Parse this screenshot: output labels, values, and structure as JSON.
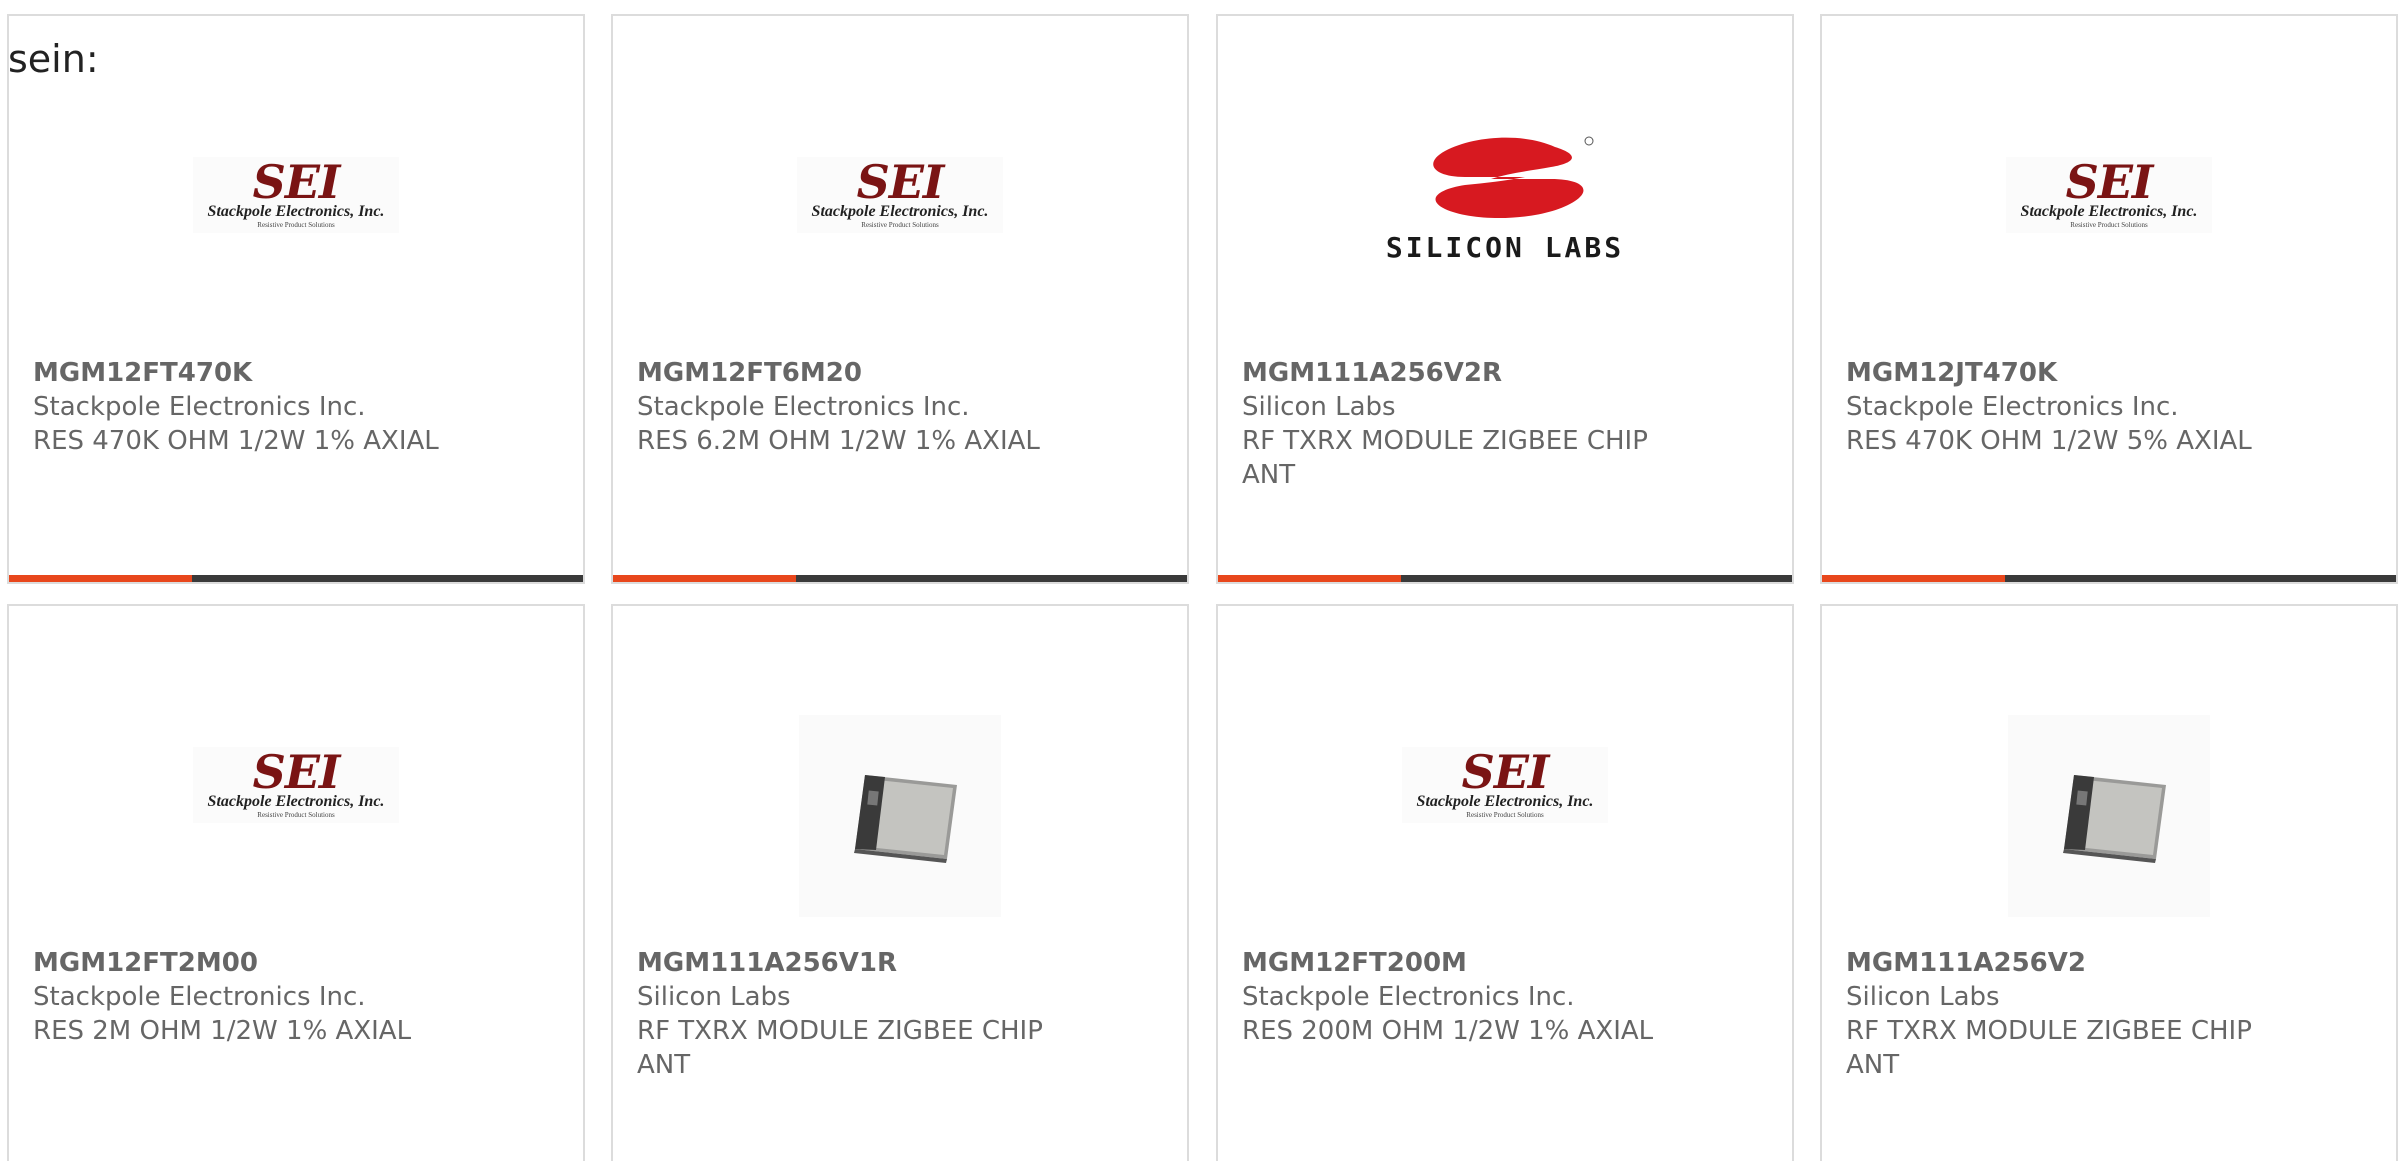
{
  "intro_text": "sein:",
  "colors": {
    "accent": "#e8471c",
    "bar_dark": "#3a3a3a",
    "sei_red": "#7a1414",
    "silabs_red": "#d71920",
    "text_gray": "#666666",
    "card_border": "#dcdcdc"
  },
  "sei_logo": {
    "mark": "SEI",
    "name": "Stackpole Electronics, Inc.",
    "tagline": "Resistive Product Solutions"
  },
  "silabs_logo": {
    "text": "SILICON LABS"
  },
  "products": [
    {
      "image": "sei-logo",
      "part_number": "MGM12FT470K",
      "manufacturer": "Stackpole Electronics Inc.",
      "description": "RES 470K OHM 1/2W 1% AXIAL"
    },
    {
      "image": "sei-logo",
      "part_number": "MGM12FT6M20",
      "manufacturer": "Stackpole Electronics Inc.",
      "description": "RES 6.2M OHM 1/2W 1% AXIAL"
    },
    {
      "image": "silicon-labs-logo",
      "part_number": "MGM111A256V2R",
      "manufacturer": "Silicon Labs",
      "description": "RF TXRX MODULE ZIGBEE CHIP ANT"
    },
    {
      "image": "sei-logo",
      "part_number": "MGM12JT470K",
      "manufacturer": "Stackpole Electronics Inc.",
      "description": "RES 470K OHM 1/2W 5% AXIAL"
    },
    {
      "image": "sei-logo",
      "part_number": "MGM12FT2M00",
      "manufacturer": "Stackpole Electronics Inc.",
      "description": "RES 2M OHM 1/2W 1% AXIAL"
    },
    {
      "image": "module-photo",
      "part_number": "MGM111A256V1R",
      "manufacturer": "Silicon Labs",
      "description": "RF TXRX MODULE ZIGBEE CHIP ANT"
    },
    {
      "image": "sei-logo",
      "part_number": "MGM12FT200M",
      "manufacturer": "Stackpole Electronics Inc.",
      "description": "RES 200M OHM 1/2W 1% AXIAL"
    },
    {
      "image": "module-photo",
      "part_number": "MGM111A256V2",
      "manufacturer": "Silicon Labs",
      "description": "RF TXRX MODULE ZIGBEE CHIP ANT"
    }
  ]
}
